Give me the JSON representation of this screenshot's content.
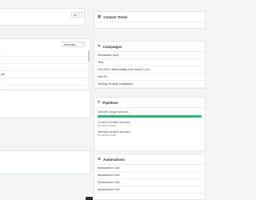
{
  "left_top_dropdown": {
    "value": "All"
  },
  "left_list": {
    "dropdown_value": "Interaction",
    "rows": [
      "...",
      "...",
      "...",
      "om",
      "...",
      "..."
    ]
  },
  "contact_trend": {
    "title": "Contact Trend"
  },
  "campaigns": {
    "title": "Campaigns",
    "items": [
      "Newsletter April",
      "Test",
      "Oct 2020 deliverability test round 3 (Gi...",
      "Inbt #3",
      "Testing Shopify integration"
    ]
  },
  "pipelines": {
    "title": "Pipelines",
    "progress_fraction": 1.0,
    "groups": [
      {
        "name": "Website design services",
        "status": ""
      },
      {
        "name": "Content creation services",
        "status": "No deals found"
      },
      {
        "name": "Website creation services",
        "status": "No deals found"
      }
    ]
  },
  "automations": {
    "title": "Automations",
    "items": [
      "Abandoned Cart",
      "Abandoned Cart",
      "Abandoned Cart",
      "Abandoned Cart"
    ]
  },
  "colors": {
    "accent": "#2bb673",
    "bar": "#2bb673"
  }
}
